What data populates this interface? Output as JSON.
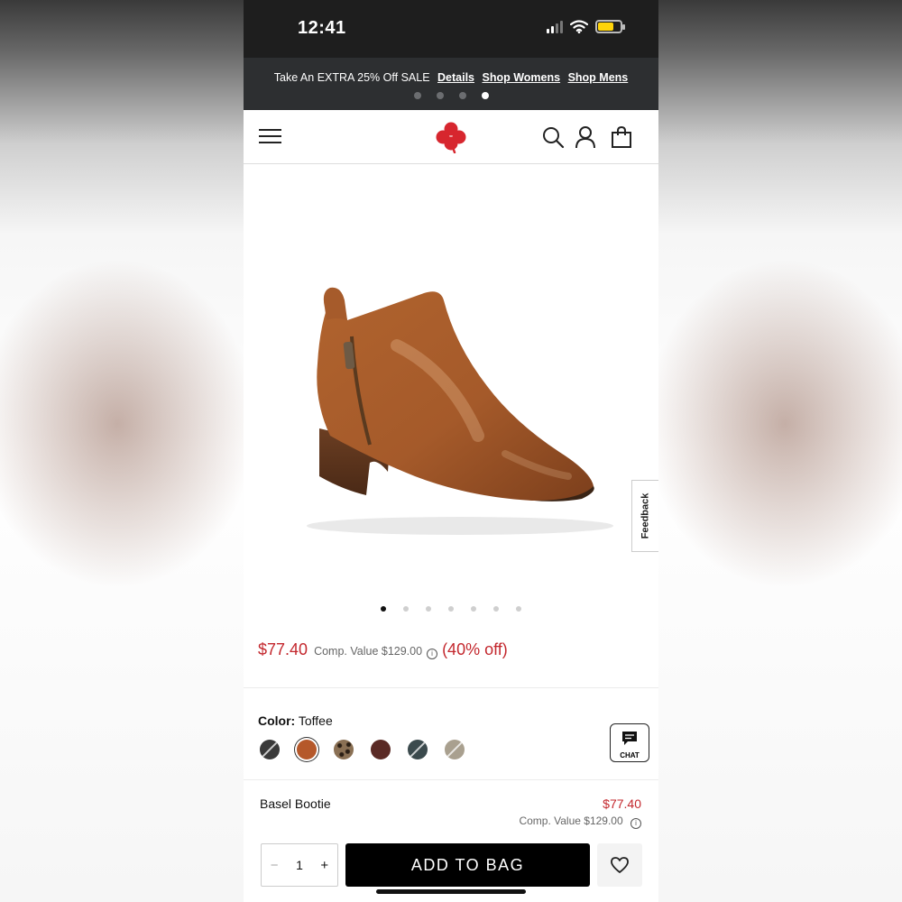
{
  "status_bar": {
    "time": "12:41",
    "battery_level": 0.7,
    "battery_color": "#ffd40a"
  },
  "promo": {
    "text": "Take An EXTRA 25% Off SALE",
    "links": [
      "Details",
      "Shop Womens",
      "Shop Mens"
    ],
    "active_slide": 4,
    "slide_count": 4
  },
  "header": {
    "icons": [
      "menu-icon",
      "clover-logo",
      "search-icon",
      "account-icon",
      "bag-icon"
    ],
    "logo_color": "#d7262e"
  },
  "product": {
    "feedback_label": "Feedback",
    "image_dots": 7,
    "active_image": 1,
    "price": "$77.40",
    "comp_value": "Comp. Value $129.00",
    "discount": "(40% off)",
    "price_color": "#c3272d"
  },
  "color": {
    "label": "Color:",
    "selected": "Toffee",
    "swatches": [
      {
        "name": "black",
        "color": "#3a3a3a"
      },
      {
        "name": "toffee",
        "color": "#b5582a"
      },
      {
        "name": "leopard",
        "color": "#5a4a3a"
      },
      {
        "name": "burgundy",
        "color": "#5a2a25"
      },
      {
        "name": "slate",
        "color": "#3b4a4d"
      },
      {
        "name": "taupe",
        "color": "#a9a08f"
      }
    ]
  },
  "chat": {
    "label": "CHAT"
  },
  "summary": {
    "name": "Basel Bootie",
    "price": "$77.40",
    "comp_value": "Comp. Value $129.00"
  },
  "buy": {
    "quantity": "1",
    "minus": "−",
    "plus": "+",
    "add_to_bag": "ADD TO BAG"
  }
}
